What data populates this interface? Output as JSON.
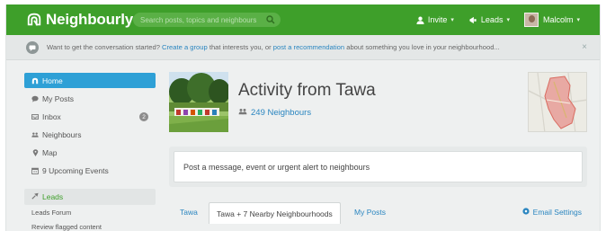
{
  "topbar": {
    "brand": "Neighbourly",
    "search_placeholder": "Search posts, topics and neighbours",
    "invite_label": "Invite",
    "leads_label": "Leads",
    "user_name": "Malcolm"
  },
  "announcement": {
    "text_before": "Want to get the conversation started? ",
    "link_group": "Create a group",
    "text_middle": " that interests you, or ",
    "link_recommendation": "post a recommendation",
    "text_after": " about something you love in your neighbourhood...",
    "close": "×"
  },
  "sidebar": {
    "items": [
      {
        "label": "Home",
        "icon": "home-icon"
      },
      {
        "label": "My Posts",
        "icon": "speech-icon"
      },
      {
        "label": "Inbox",
        "icon": "inbox-icon",
        "badge": "2"
      },
      {
        "label": "Neighbours",
        "icon": "people-icon"
      },
      {
        "label": "Map",
        "icon": "pin-icon"
      },
      {
        "label": "9 Upcoming Events",
        "icon": "calendar-icon"
      }
    ],
    "section": {
      "label": "Leads",
      "icon": "megaphone-icon"
    },
    "sub_items": [
      "Leads Forum",
      "Review flagged content"
    ]
  },
  "main": {
    "title": "Activity from Tawa",
    "neighbours": "249 Neighbours",
    "post_placeholder": "Post a message, event or urgent alert to neighbours",
    "tabs": [
      "Tawa",
      "Tawa + 7 Nearby Neighbourhoods",
      "My Posts"
    ],
    "email_settings": "Email Settings"
  },
  "colors": {
    "brand_green": "#3e9f2a",
    "active_blue": "#2ea0d6",
    "link_blue": "#2b86c0"
  }
}
